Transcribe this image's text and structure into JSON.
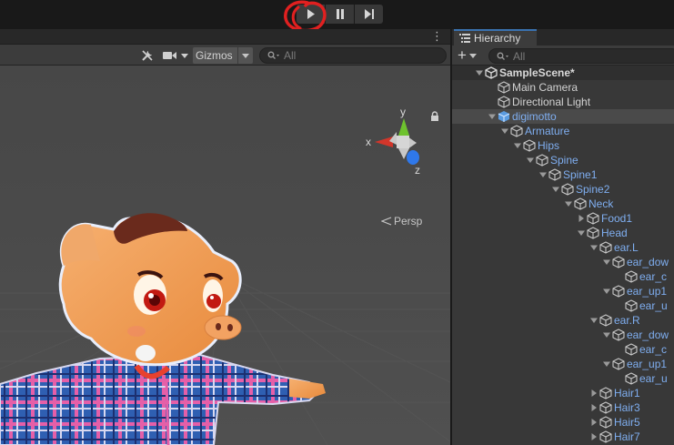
{
  "playbar": {
    "play_icon": "play-icon",
    "pause_icon": "pause-icon",
    "step_icon": "step-icon",
    "annotation_color": "#e02020"
  },
  "scene": {
    "menu_glyph": "⋮",
    "toolbar": {
      "tools_icon": "tools-icon",
      "camera_icon": "camera-icon",
      "gizmos_label": "Gizmos",
      "search_placeholder": "All"
    },
    "gizmo": {
      "x_label": "x",
      "y_label": "y",
      "z_label": "z",
      "persp_label": "Persp"
    },
    "colors": {
      "background": "#4a4a4a",
      "grid": "#5a5a5a",
      "shirt_blue": "#2d5fb0",
      "skin": "#f2a05a"
    }
  },
  "hierarchy": {
    "tab_label": "Hierarchy",
    "add_label": "+",
    "search_placeholder": "All",
    "items": [
      {
        "label": "SampleScene*",
        "depth": 0,
        "expanded": true,
        "has_children": true,
        "kind": "scene"
      },
      {
        "label": "Main Camera",
        "depth": 1,
        "expanded": false,
        "has_children": false,
        "kind": "object"
      },
      {
        "label": "Directional Light",
        "depth": 1,
        "expanded": false,
        "has_children": false,
        "kind": "object"
      },
      {
        "label": "digimotto",
        "depth": 1,
        "expanded": true,
        "has_children": true,
        "kind": "prefab-root"
      },
      {
        "label": "Armature",
        "depth": 2,
        "expanded": true,
        "has_children": true,
        "kind": "prefab"
      },
      {
        "label": "Hips",
        "depth": 3,
        "expanded": true,
        "has_children": true,
        "kind": "prefab"
      },
      {
        "label": "Spine",
        "depth": 4,
        "expanded": true,
        "has_children": true,
        "kind": "prefab"
      },
      {
        "label": "Spine1",
        "depth": 5,
        "expanded": true,
        "has_children": true,
        "kind": "prefab"
      },
      {
        "label": "Spine2",
        "depth": 6,
        "expanded": true,
        "has_children": true,
        "kind": "prefab"
      },
      {
        "label": "Neck",
        "depth": 7,
        "expanded": true,
        "has_children": true,
        "kind": "prefab"
      },
      {
        "label": "Food1",
        "depth": 8,
        "expanded": false,
        "has_children": true,
        "kind": "prefab"
      },
      {
        "label": "Head",
        "depth": 8,
        "expanded": true,
        "has_children": true,
        "kind": "prefab"
      },
      {
        "label": "ear.L",
        "depth": 9,
        "expanded": true,
        "has_children": true,
        "kind": "prefab"
      },
      {
        "label": "ear_dow",
        "depth": 10,
        "expanded": true,
        "has_children": true,
        "kind": "prefab"
      },
      {
        "label": "ear_c",
        "depth": 11,
        "expanded": false,
        "has_children": false,
        "kind": "prefab"
      },
      {
        "label": "ear_up1",
        "depth": 10,
        "expanded": true,
        "has_children": true,
        "kind": "prefab"
      },
      {
        "label": "ear_u",
        "depth": 11,
        "expanded": false,
        "has_children": false,
        "kind": "prefab"
      },
      {
        "label": "ear.R",
        "depth": 9,
        "expanded": true,
        "has_children": true,
        "kind": "prefab"
      },
      {
        "label": "ear_dow",
        "depth": 10,
        "expanded": true,
        "has_children": true,
        "kind": "prefab"
      },
      {
        "label": "ear_c",
        "depth": 11,
        "expanded": false,
        "has_children": false,
        "kind": "prefab"
      },
      {
        "label": "ear_up1",
        "depth": 10,
        "expanded": true,
        "has_children": true,
        "kind": "prefab"
      },
      {
        "label": "ear_u",
        "depth": 11,
        "expanded": false,
        "has_children": false,
        "kind": "prefab"
      },
      {
        "label": "Hair1",
        "depth": 9,
        "expanded": false,
        "has_children": true,
        "kind": "prefab"
      },
      {
        "label": "Hair3",
        "depth": 9,
        "expanded": false,
        "has_children": true,
        "kind": "prefab"
      },
      {
        "label": "Hair5",
        "depth": 9,
        "expanded": false,
        "has_children": true,
        "kind": "prefab"
      },
      {
        "label": "Hair7",
        "depth": 9,
        "expanded": false,
        "has_children": true,
        "kind": "prefab"
      }
    ]
  }
}
